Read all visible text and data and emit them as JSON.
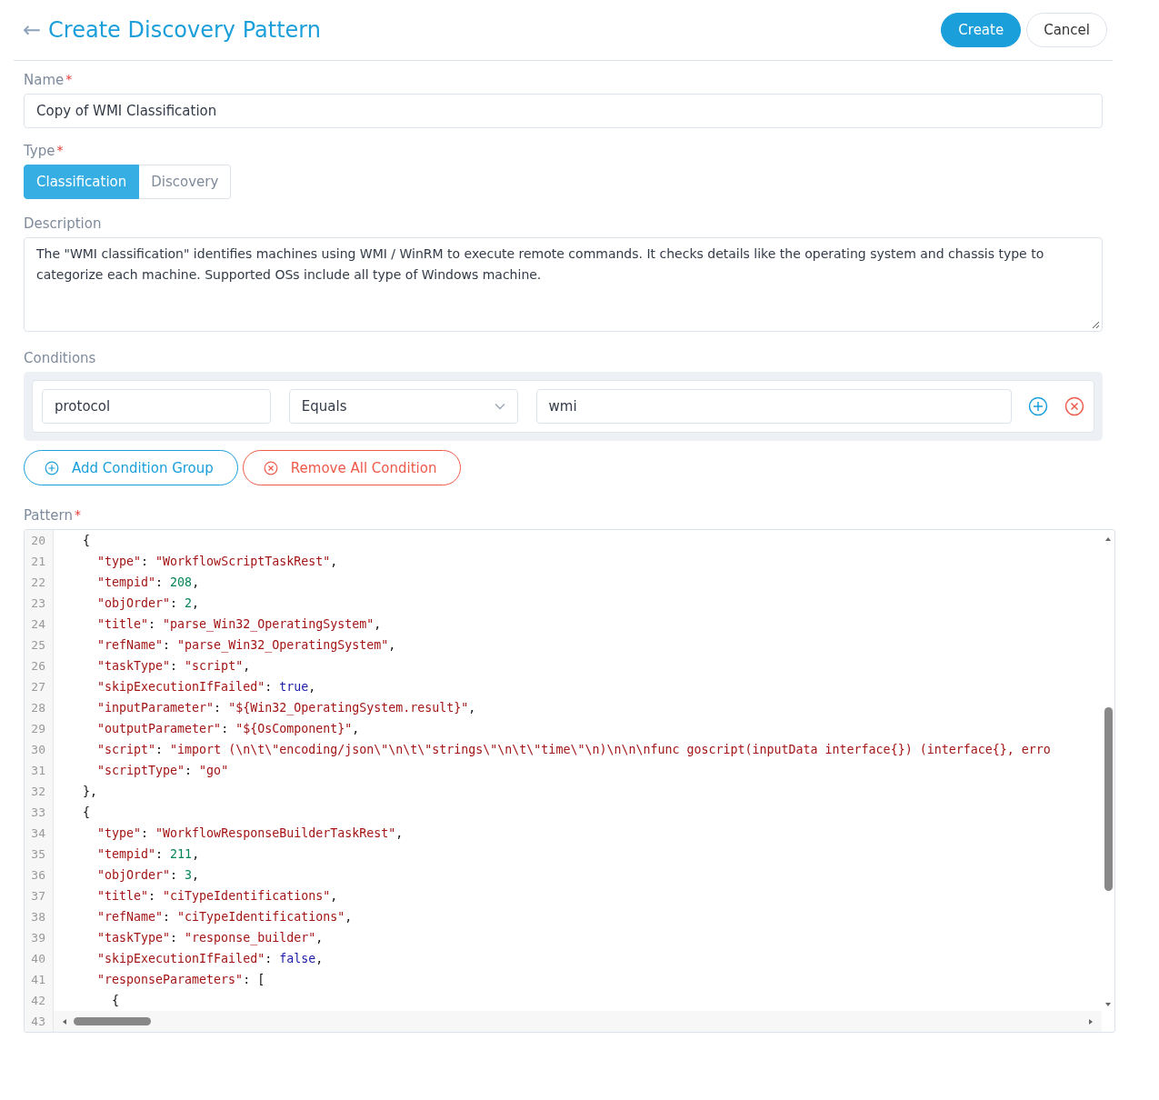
{
  "header": {
    "back": "←",
    "title": "Create Discovery Pattern",
    "buttons": [
      {
        "label": "Create",
        "kind": "primary"
      },
      {
        "label": "Cancel",
        "kind": "secondary"
      }
    ]
  },
  "name_field": {
    "label": "Name",
    "required_mark": "*",
    "value": "Copy of WMI Classification"
  },
  "type_field": {
    "label": "Type",
    "required_mark": "*",
    "options": [
      {
        "label": "Classification",
        "selected": true
      },
      {
        "label": "Discovery",
        "selected": false
      }
    ]
  },
  "description": {
    "label": "Description",
    "value": "The \"WMI classification\" identifies machines using WMI / WinRM to execute remote commands. It checks details like the operating system and chassis type to categorize each machine. Supported OSs include all type of Windows machine."
  },
  "conditions": {
    "label": "Conditions",
    "rows": [
      {
        "field": "protocol",
        "operator": "Equals",
        "value": "wmi"
      }
    ],
    "buttons": [
      {
        "label": "Add Condition Group",
        "kind": "add"
      },
      {
        "label": "Remove All Condition",
        "kind": "remove"
      }
    ]
  },
  "pattern": {
    "label": "Pattern",
    "required_mark": "*",
    "lines": [
      {
        "number": "20",
        "tokens": [
          {
            "kind": "punct",
            "text": "  {"
          }
        ]
      },
      {
        "number": "21",
        "tokens": [
          {
            "kind": "key",
            "text": "    \"type\""
          },
          {
            "kind": "punct",
            "text": ": "
          },
          {
            "kind": "string",
            "text": "\"WorkflowScriptTaskRest\""
          },
          {
            "kind": "punct",
            "text": ","
          }
        ]
      },
      {
        "number": "22",
        "tokens": [
          {
            "kind": "key",
            "text": "    \"tempid\""
          },
          {
            "kind": "punct",
            "text": ": "
          },
          {
            "kind": "number",
            "text": "208"
          },
          {
            "kind": "punct",
            "text": ","
          }
        ]
      },
      {
        "number": "23",
        "tokens": [
          {
            "kind": "key",
            "text": "    \"objOrder\""
          },
          {
            "kind": "punct",
            "text": ": "
          },
          {
            "kind": "number",
            "text": "2"
          },
          {
            "kind": "punct",
            "text": ","
          }
        ]
      },
      {
        "number": "24",
        "tokens": [
          {
            "kind": "key",
            "text": "    \"title\""
          },
          {
            "kind": "punct",
            "text": ": "
          },
          {
            "kind": "string",
            "text": "\"parse_Win32_OperatingSystem\""
          },
          {
            "kind": "punct",
            "text": ","
          }
        ]
      },
      {
        "number": "25",
        "tokens": [
          {
            "kind": "key",
            "text": "    \"refName\""
          },
          {
            "kind": "punct",
            "text": ": "
          },
          {
            "kind": "string",
            "text": "\"parse_Win32_OperatingSystem\""
          },
          {
            "kind": "punct",
            "text": ","
          }
        ]
      },
      {
        "number": "26",
        "tokens": [
          {
            "kind": "key",
            "text": "    \"taskType\""
          },
          {
            "kind": "punct",
            "text": ": "
          },
          {
            "kind": "string",
            "text": "\"script\""
          },
          {
            "kind": "punct",
            "text": ","
          }
        ]
      },
      {
        "number": "27",
        "tokens": [
          {
            "kind": "key",
            "text": "    \"skipExecutionIfFailed\""
          },
          {
            "kind": "punct",
            "text": ": "
          },
          {
            "kind": "bool",
            "text": "true"
          },
          {
            "kind": "punct",
            "text": ","
          }
        ]
      },
      {
        "number": "28",
        "tokens": [
          {
            "kind": "key",
            "text": "    \"inputParameter\""
          },
          {
            "kind": "punct",
            "text": ": "
          },
          {
            "kind": "string",
            "text": "\"${Win32_OperatingSystem.result}\""
          },
          {
            "kind": "punct",
            "text": ","
          }
        ]
      },
      {
        "number": "29",
        "tokens": [
          {
            "kind": "key",
            "text": "    \"outputParameter\""
          },
          {
            "kind": "punct",
            "text": ": "
          },
          {
            "kind": "string",
            "text": "\"${OsComponent}\""
          },
          {
            "kind": "punct",
            "text": ","
          }
        ]
      },
      {
        "number": "30",
        "tokens": [
          {
            "kind": "key",
            "text": "    \"script\""
          },
          {
            "kind": "punct",
            "text": ": "
          },
          {
            "kind": "string",
            "text": "\"import (\\n\\t\\\"encoding/json\\\"\\n\\t\\\"strings\\\"\\n\\t\\\"time\\\"\\n)\\n\\n\\nfunc goscript(inputData interface{}) (interface{}, erro"
          }
        ]
      },
      {
        "number": "31",
        "tokens": [
          {
            "kind": "key",
            "text": "    \"scriptType\""
          },
          {
            "kind": "punct",
            "text": ": "
          },
          {
            "kind": "string",
            "text": "\"go\""
          }
        ]
      },
      {
        "number": "32",
        "tokens": [
          {
            "kind": "punct",
            "text": "  },"
          }
        ]
      },
      {
        "number": "33",
        "tokens": [
          {
            "kind": "punct",
            "text": "  {"
          }
        ]
      },
      {
        "number": "34",
        "tokens": [
          {
            "kind": "key",
            "text": "    \"type\""
          },
          {
            "kind": "punct",
            "text": ": "
          },
          {
            "kind": "string",
            "text": "\"WorkflowResponseBuilderTaskRest\""
          },
          {
            "kind": "punct",
            "text": ","
          }
        ]
      },
      {
        "number": "35",
        "tokens": [
          {
            "kind": "key",
            "text": "    \"tempid\""
          },
          {
            "kind": "punct",
            "text": ": "
          },
          {
            "kind": "number",
            "text": "211"
          },
          {
            "kind": "punct",
            "text": ","
          }
        ]
      },
      {
        "number": "36",
        "tokens": [
          {
            "kind": "key",
            "text": "    \"objOrder\""
          },
          {
            "kind": "punct",
            "text": ": "
          },
          {
            "kind": "number",
            "text": "3"
          },
          {
            "kind": "punct",
            "text": ","
          }
        ]
      },
      {
        "number": "37",
        "tokens": [
          {
            "kind": "key",
            "text": "    \"title\""
          },
          {
            "kind": "punct",
            "text": ": "
          },
          {
            "kind": "string",
            "text": "\"ciTypeIdentifications\""
          },
          {
            "kind": "punct",
            "text": ","
          }
        ]
      },
      {
        "number": "38",
        "tokens": [
          {
            "kind": "key",
            "text": "    \"refName\""
          },
          {
            "kind": "punct",
            "text": ": "
          },
          {
            "kind": "string",
            "text": "\"ciTypeIdentifications\""
          },
          {
            "kind": "punct",
            "text": ","
          }
        ]
      },
      {
        "number": "39",
        "tokens": [
          {
            "kind": "key",
            "text": "    \"taskType\""
          },
          {
            "kind": "punct",
            "text": ": "
          },
          {
            "kind": "string",
            "text": "\"response_builder\""
          },
          {
            "kind": "punct",
            "text": ","
          }
        ]
      },
      {
        "number": "40",
        "tokens": [
          {
            "kind": "key",
            "text": "    \"skipExecutionIfFailed\""
          },
          {
            "kind": "punct",
            "text": ": "
          },
          {
            "kind": "bool",
            "text": "false"
          },
          {
            "kind": "punct",
            "text": ","
          }
        ]
      },
      {
        "number": "41",
        "tokens": [
          {
            "kind": "key",
            "text": "    \"responseParameters\""
          },
          {
            "kind": "punct",
            "text": ": "
          },
          {
            "kind": "punct",
            "text": "["
          }
        ]
      },
      {
        "number": "42",
        "tokens": [
          {
            "kind": "punct",
            "text": "      {"
          }
        ]
      }
    ],
    "last_number": "43"
  }
}
